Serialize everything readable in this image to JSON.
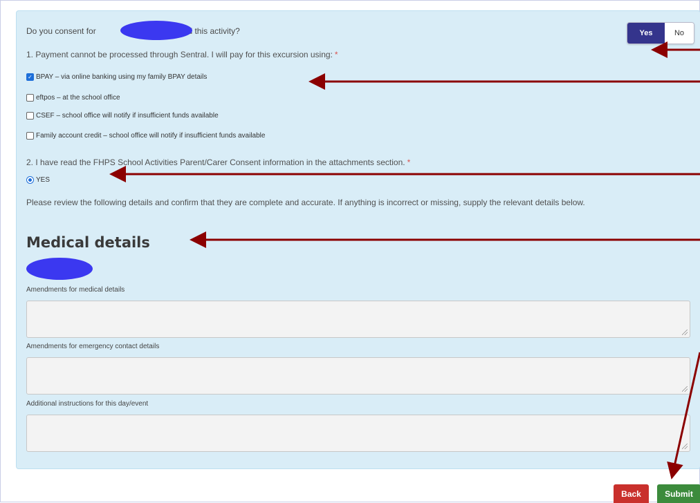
{
  "consent": {
    "question_prefix": "Do you consent for",
    "question_suffix": "to attend this activity?",
    "yes_label": "Yes",
    "no_label": "No",
    "selected": "Yes"
  },
  "question1": {
    "text": "1. Payment cannot be processed through Sentral. I will pay for this excursion using:",
    "required_mark": "*",
    "options": [
      {
        "label": "BPAY – via online banking using my family BPAY details",
        "checked": true
      },
      {
        "label": "eftpos – at the school office",
        "checked": false
      },
      {
        "label": "CSEF – school office will notify if insufficient funds available",
        "checked": false
      },
      {
        "label": "Family account credit – school office will notify if insufficient funds available",
        "checked": false
      }
    ]
  },
  "question2": {
    "text": "2. I have read the FHPS School Activities Parent/Carer Consent information in the attachments section.",
    "required_mark": "*",
    "option_label": "YES",
    "selected": true
  },
  "review_text": "Please review the following details and confirm that they are complete and accurate. If anything is incorrect or missing, supply the relevant details below.",
  "medical_heading": "Medical details",
  "fields": {
    "medical_label": "Amendments for medical details",
    "emergency_label": "Amendments for emergency contact details",
    "instructions_label": "Additional instructions for this day/event"
  },
  "buttons": {
    "back_label": "Back",
    "submit_label": "Submit"
  },
  "colors": {
    "panel_bg": "#d9edf7",
    "toggle_active": "#34348c",
    "back_button": "#c9302c",
    "submit_button": "#3c8b3c",
    "annotation_arrow": "#8b0000",
    "redaction": "#3b38f0"
  }
}
